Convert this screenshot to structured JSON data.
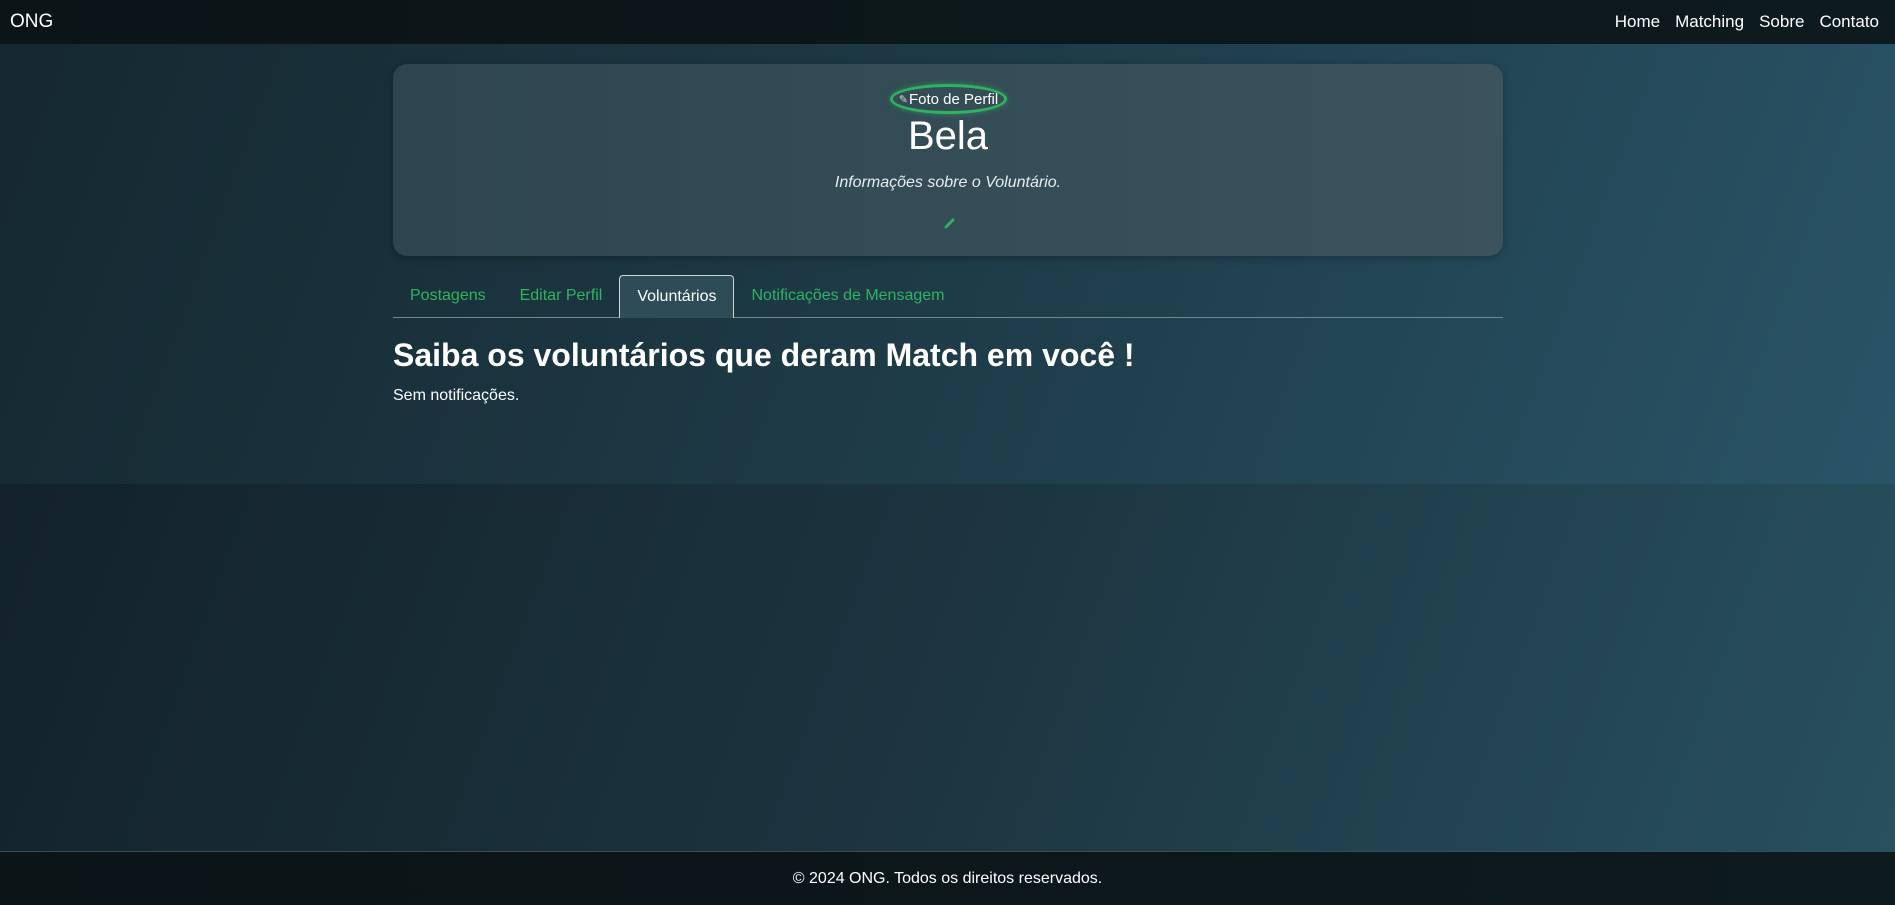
{
  "navbar": {
    "brand": "ONG",
    "links": [
      "Home",
      "Matching",
      "Sobre",
      "Contato"
    ]
  },
  "profile": {
    "avatar_alt": "Foto de Perfil",
    "name": "Bela",
    "info": "Informações sobre o Voluntário.",
    "edit_icon": "pencil-icon"
  },
  "tabs": [
    {
      "label": "Postagens",
      "active": false
    },
    {
      "label": "Editar Perfil",
      "active": false
    },
    {
      "label": "Voluntários",
      "active": true
    },
    {
      "label": "Notificações de Mensagem",
      "active": false
    }
  ],
  "section": {
    "title": "Saiba os voluntários que deram Match em você !",
    "empty": "Sem notificações."
  },
  "footer": {
    "text": "© 2024 ONG. Todos os direitos reservados."
  },
  "colors": {
    "accent": "#2fb360",
    "nav_bg": "#0b1417",
    "card_bg": "#3b535d"
  }
}
